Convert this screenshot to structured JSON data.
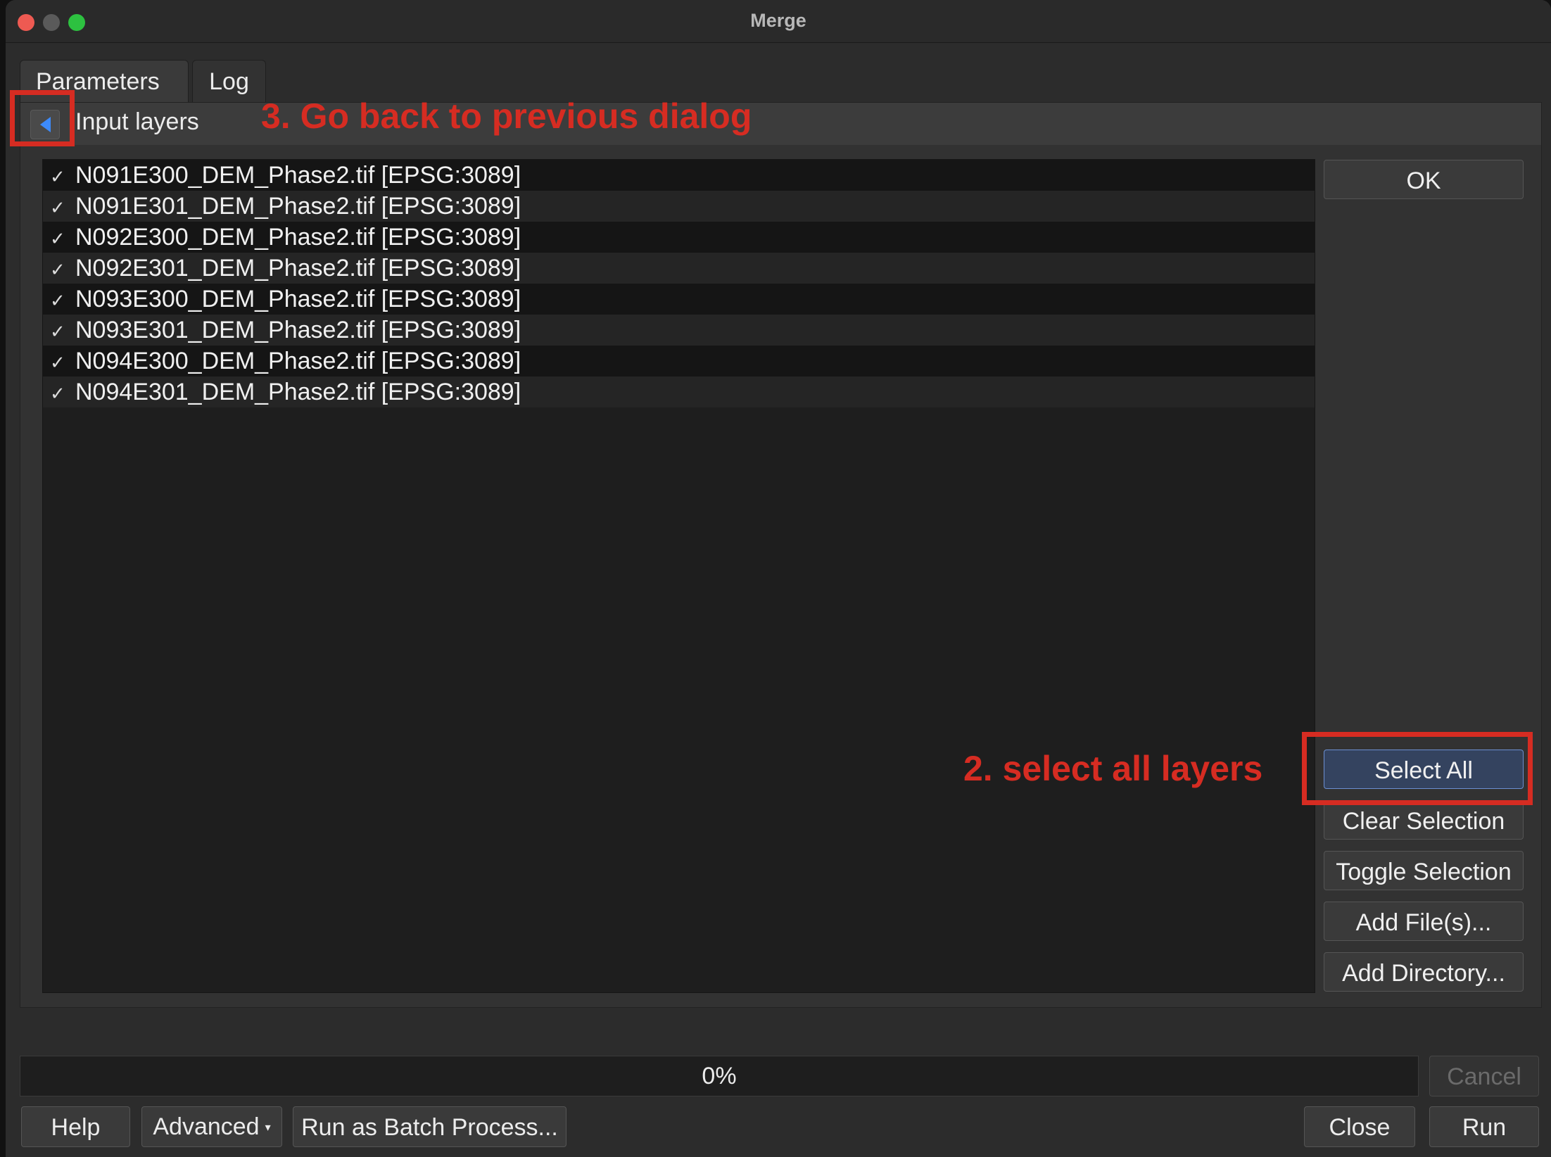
{
  "window": {
    "title": "Merge"
  },
  "tabs": [
    {
      "label": "Parameters",
      "active": true
    },
    {
      "label": "Log",
      "active": false
    }
  ],
  "group": {
    "label": "Input layers"
  },
  "layers": [
    {
      "label": "N091E300_DEM_Phase2.tif [EPSG:3089]",
      "checked": true
    },
    {
      "label": "N091E301_DEM_Phase2.tif [EPSG:3089]",
      "checked": true
    },
    {
      "label": "N092E300_DEM_Phase2.tif [EPSG:3089]",
      "checked": true
    },
    {
      "label": "N092E301_DEM_Phase2.tif [EPSG:3089]",
      "checked": true
    },
    {
      "label": "N093E300_DEM_Phase2.tif [EPSG:3089]",
      "checked": true
    },
    {
      "label": "N093E301_DEM_Phase2.tif [EPSG:3089]",
      "checked": true
    },
    {
      "label": "N094E300_DEM_Phase2.tif [EPSG:3089]",
      "checked": true
    },
    {
      "label": "N094E301_DEM_Phase2.tif [EPSG:3089]",
      "checked": true
    }
  ],
  "check_mark": "✓",
  "side_buttons": {
    "ok": "OK",
    "select_all": "Select All",
    "clear_selection": "Clear Selection",
    "toggle_selection": "Toggle Selection",
    "add_files": "Add File(s)...",
    "add_directory": "Add Directory..."
  },
  "annotations": {
    "step2": "2. select all layers",
    "step3": "3. Go back to previous dialog",
    "color": "#d62c22"
  },
  "progress": {
    "text": "0%",
    "value": 0
  },
  "bottom_buttons": {
    "cancel": "Cancel",
    "help": "Help",
    "advanced": "Advanced",
    "batch": "Run as Batch Process...",
    "close": "Close",
    "run": "Run"
  },
  "colors": {
    "accent": "#3d8bfd",
    "selected_button": "#34435f"
  }
}
